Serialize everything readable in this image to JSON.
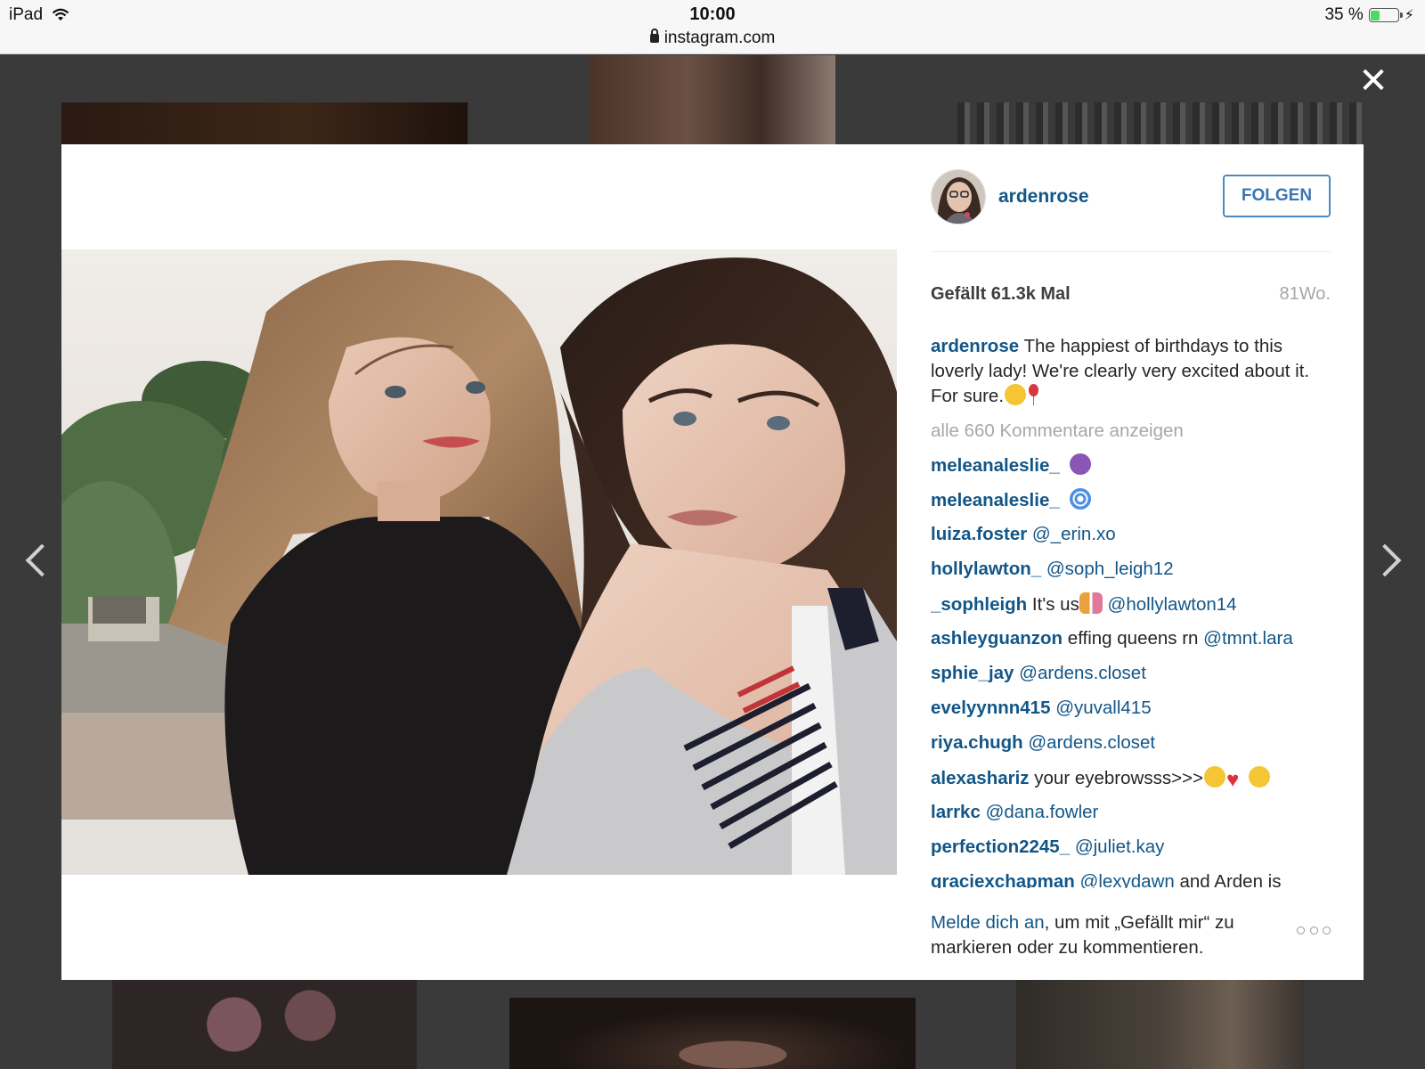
{
  "statusbar": {
    "device": "iPad",
    "time": "10:00",
    "url": "instagram.com",
    "battery": "35 %",
    "battery_level_percent": 35
  },
  "post": {
    "username": "ardenrose",
    "follow_label": "FOLGEN",
    "likes": "Gefällt 61.3k Mal",
    "age": "81Wo.",
    "caption_user": "ardenrose",
    "caption_text": "The happiest of birthdays to this loverly lady! We're clearly very excited about it. For sure.",
    "caption_emojis": [
      "neutral-face-emoji",
      "balloon-emoji"
    ],
    "show_all_comments": "alle 660 Kommentare anzeigen",
    "comments": [
      {
        "user": "meleanaleslie_",
        "text": "",
        "mention": "",
        "emoji": "smiling-imp-emoji"
      },
      {
        "user": "meleanaleslie_",
        "text": "",
        "mention": "",
        "emoji": "cyclone-emoji"
      },
      {
        "user": "luiza.foster",
        "text": "",
        "mention": "@_erin.xo"
      },
      {
        "user": "hollylawton_",
        "text": "",
        "mention": "@soph_leigh12"
      },
      {
        "user": "_sophleigh",
        "text": "It's us",
        "mention": "@hollylawton14",
        "emoji": "two-women-emoji"
      },
      {
        "user": "ashleyguanzon",
        "text": "effing queens rn",
        "mention": "@tmnt.lara"
      },
      {
        "user": "sphie_jay",
        "text": "",
        "mention": "@ardens.closet"
      },
      {
        "user": "evelyynnn415",
        "text": "",
        "mention": "@yuvall415"
      },
      {
        "user": "riya.chugh",
        "text": "",
        "mention": "@ardens.closet"
      },
      {
        "user": "alexashariz",
        "text": "your eyebrowsss>>>",
        "mention": "",
        "emoji": "crying-heart-heart-eyes-emoji"
      },
      {
        "user": "larrkc",
        "text": "",
        "mention": "@dana.fowler"
      },
      {
        "user": "perfection2245_",
        "text": "",
        "mention": "@juliet.kay"
      },
      {
        "user": "graciexchapman",
        "text": "and Arden is",
        "mention": "@lexydawn"
      }
    ],
    "login_link": "Melde dich an",
    "login_text": ", um mit „Gefällt mir“ zu markieren oder zu kommentieren."
  },
  "icons": {
    "close": "close-icon",
    "prev": "chevron-left-icon",
    "next": "chevron-right-icon",
    "more": "more-options-icon"
  }
}
